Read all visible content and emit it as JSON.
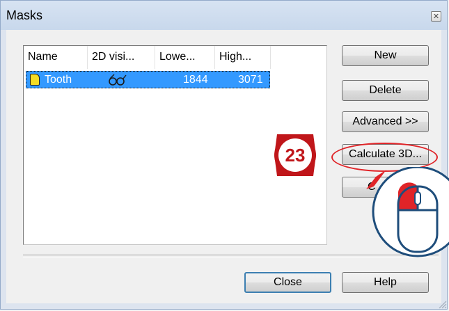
{
  "window": {
    "title": "Masks",
    "close_glyph": "✕"
  },
  "list": {
    "columns": [
      "Name",
      "2D visi...",
      "Lowe...",
      "High..."
    ],
    "rows": [
      {
        "name": "Tooth",
        "visibility_icon": "glasses-icon",
        "lower": "1844",
        "higher": "3071",
        "color": "#f4dc25",
        "selected": true
      }
    ]
  },
  "buttons": {
    "new": "New",
    "delete": "Delete",
    "advanced": "Advanced  >>",
    "calculate3d": "Calculate 3D...",
    "partial": "C",
    "close": "Close",
    "help": "Help"
  },
  "annotation": {
    "step": "23",
    "accent": "#e02428"
  }
}
